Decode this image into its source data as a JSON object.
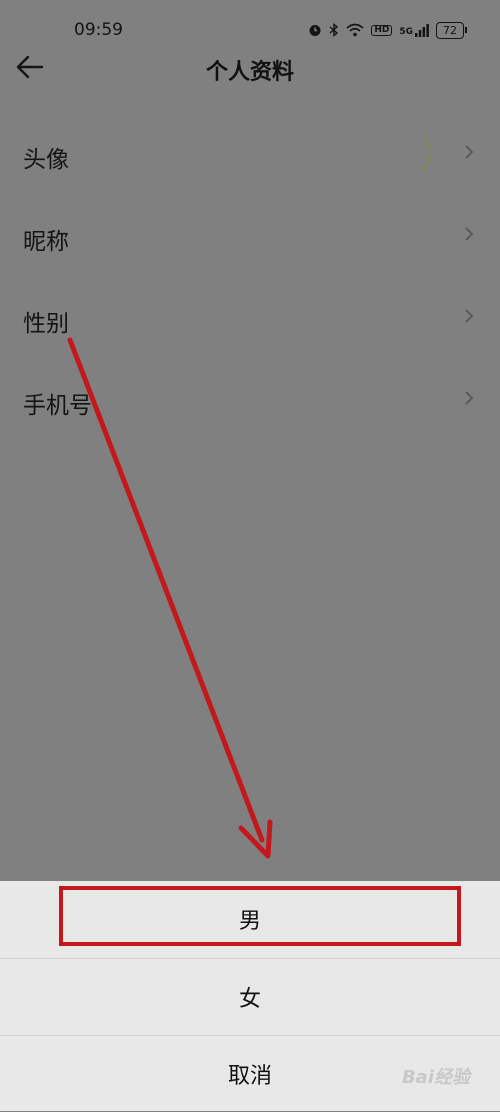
{
  "status_bar": {
    "time": "09:59",
    "icons": [
      "alarm-icon",
      "bluetooth-icon",
      "wifi-icon",
      "hd-icon",
      "signal-icon"
    ],
    "hd_label": "HD",
    "network_label": "5G",
    "battery": "72"
  },
  "header": {
    "title": "个人资料",
    "back_icon": "back-arrow-icon"
  },
  "list": {
    "items": [
      {
        "label": "头像"
      },
      {
        "label": "昵称"
      },
      {
        "label": "性别"
      },
      {
        "label": "手机号"
      }
    ]
  },
  "sheet": {
    "options": [
      "男",
      "女"
    ],
    "cancel": "取消"
  },
  "annotation": {
    "arrow_color": "#c3181c",
    "box_color": "#c3181c"
  },
  "watermark": "Bai经验"
}
